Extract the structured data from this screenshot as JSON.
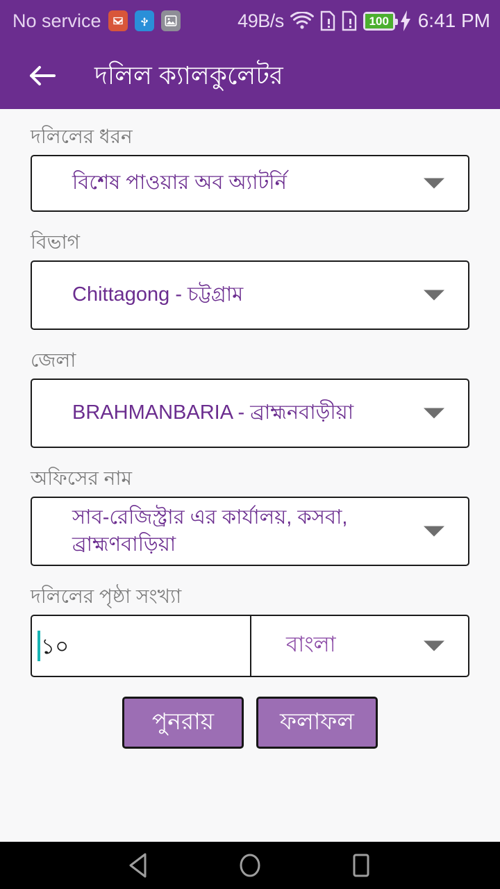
{
  "status_bar": {
    "carrier": "No service",
    "icons": [
      "mail-icon",
      "usb-icon",
      "screenshot-icon"
    ],
    "network_speed": "49B/s",
    "wifi": "wifi-icon",
    "sim1": "sim-missing-icon",
    "sim2": "sim-missing-icon",
    "battery_level": "100",
    "charging": true,
    "time": "6:41 PM"
  },
  "app_bar": {
    "back": "back-arrow-icon",
    "title": "দলিল ক্যালকুলেটর"
  },
  "form": {
    "doc_type": {
      "label": "দলিলের ধরন",
      "value": "বিশেষ পাওয়ার অব অ্যাটর্নি"
    },
    "division": {
      "label": "বিভাগ",
      "value": "Chittagong - চট্টগ্রাম"
    },
    "district": {
      "label": "জেলা",
      "value": "BRAHMANBARIA - ব্রাহ্মনবাড়ীয়া"
    },
    "office": {
      "label": "অফিসের নাম",
      "value": "সাব-রেজিস্ট্রার এর কার্যালয়, কসবা, ব্রাহ্মণবাড়িয়া"
    },
    "pages": {
      "label": "দলিলের পৃষ্ঠা সংখ্যা",
      "value": "১০",
      "placeholder": ""
    },
    "language": {
      "value": "বাংলা"
    }
  },
  "buttons": {
    "reset": "পুনরায়",
    "result": "ফলাফল"
  },
  "nav_bar": {
    "back": "nav-back-icon",
    "home": "nav-home-icon",
    "recents": "nav-recents-icon"
  },
  "colors": {
    "primary": "#6b2d8f",
    "accent_text": "#6b2d8f",
    "button_bg": "#9c6eb4",
    "cursor": "#19b5b5",
    "battery_green": "#4caf2f",
    "page_bg": "#f8f8f9"
  }
}
